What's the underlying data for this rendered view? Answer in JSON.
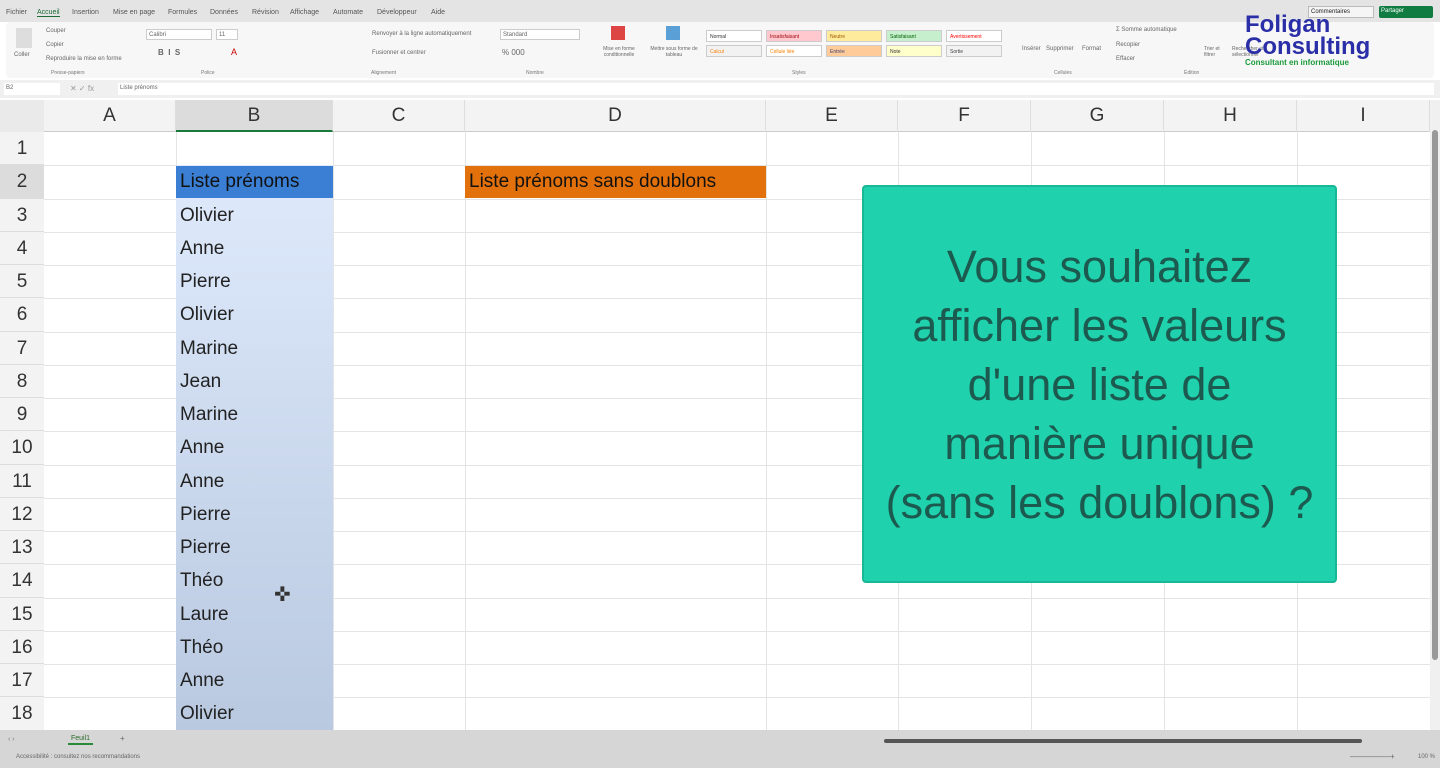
{
  "menu_tabs": [
    "Fichier",
    "Accueil",
    "Insertion",
    "Mise en page",
    "Formules",
    "Données",
    "Révision",
    "Affichage",
    "Automate",
    "Développeur",
    "Aide"
  ],
  "active_tab": "Accueil",
  "top_right": {
    "comments": "Commentaires",
    "share": "Partager"
  },
  "ribbon": {
    "clipboard": {
      "paste": "Coller",
      "cut": "Couper",
      "copy": "Copier",
      "format_painter": "Reproduire la mise en forme",
      "label": "Presse-papiers"
    },
    "font": {
      "name": "Calibri",
      "size": "11",
      "label": "Police"
    },
    "alignment": {
      "wrap": "Renvoyer à la ligne automatiquement",
      "merge": "Fusionner et centrer",
      "label": "Alignement"
    },
    "number": {
      "format": "Standard",
      "label": "Nombre"
    },
    "styles": {
      "conditional": "Mise en forme conditionnelle",
      "table": "Mettre sous forme de tableau",
      "cells": [
        {
          "label": "Normal",
          "bg": "#ffffff",
          "fg": "#333333"
        },
        {
          "label": "Insatisfaisant",
          "bg": "#ffc7ce",
          "fg": "#9c0006"
        },
        {
          "label": "Neutre",
          "bg": "#ffeb9c",
          "fg": "#9c5700"
        },
        {
          "label": "Satisfaisant",
          "bg": "#c6efce",
          "fg": "#006100"
        },
        {
          "label": "Avertissement",
          "bg": "#ffffff",
          "fg": "#ff0000"
        },
        {
          "label": "Calcul",
          "bg": "#f2f2f2",
          "fg": "#fa7d00"
        },
        {
          "label": "Cellule liée",
          "bg": "#ffffff",
          "fg": "#fa7d00"
        },
        {
          "label": "Entrée",
          "bg": "#ffcc99",
          "fg": "#3f3f76"
        },
        {
          "label": "Note",
          "bg": "#ffffcc",
          "fg": "#333333"
        },
        {
          "label": "Sortie",
          "bg": "#f2f2f2",
          "fg": "#3f3f3f"
        }
      ],
      "label": "Styles"
    },
    "cells": {
      "insert": "Insérer",
      "delete": "Supprimer",
      "format": "Format",
      "label": "Cellules"
    },
    "editing": {
      "autosum": "Somme automatique",
      "fill": "Recopier",
      "clear": "Effacer",
      "sort": "Trier et filtrer",
      "find": "Rechercher et sélectionner",
      "label": "Édition"
    }
  },
  "logo": {
    "line1": "Foligan",
    "line2": "Consulting",
    "tagline": "Consultant en informatique"
  },
  "formula_bar": {
    "name_box": "B2",
    "content": "Liste prénoms"
  },
  "columns": [
    "A",
    "B",
    "C",
    "D",
    "E",
    "F",
    "G",
    "H",
    "I"
  ],
  "rows": [
    "1",
    "2",
    "3",
    "4",
    "5",
    "6",
    "7",
    "8",
    "9",
    "10",
    "11",
    "12",
    "13",
    "14",
    "15",
    "16",
    "17",
    "18"
  ],
  "cells": {
    "B2": "Liste prénoms",
    "D2": "Liste prénoms sans doublons",
    "names": [
      "Olivier",
      "Anne",
      "Pierre",
      "Olivier",
      "Marine",
      "Jean",
      "Marine",
      "Anne",
      "Anne",
      "Pierre",
      "Pierre",
      "Théo",
      "Laure",
      "Théo",
      "Anne",
      "Olivier"
    ]
  },
  "callout": "Vous souhaitez afficher les valeurs d'une liste de manière unique (sans les doublons) ?",
  "sheet_tab": "Feuil1",
  "status": {
    "accessibility": "Accessibilité : consultez nos recommandations",
    "zoom": "100 %"
  },
  "colors": {
    "header_blue": "#3a7fd3",
    "header_orange": "#e2710c",
    "callout": "#1fd1ad",
    "share_green": "#107c41"
  }
}
